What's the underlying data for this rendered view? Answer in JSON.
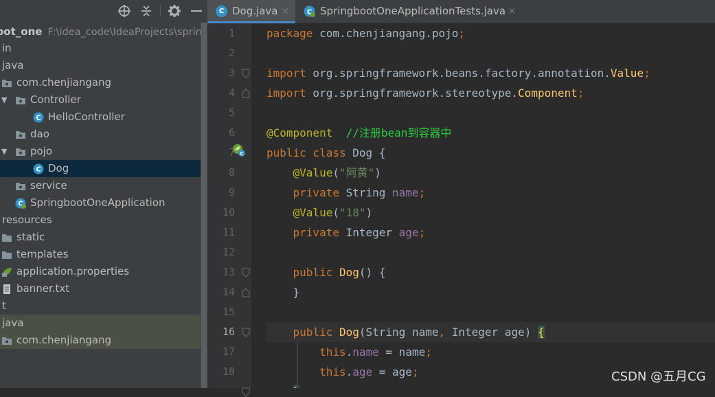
{
  "project": {
    "root_name": "oot_one",
    "root_path": "F:\\idea_code\\IdeaProjects\\spring",
    "toolbar": {
      "locate_icon": "crosshair-icon",
      "collapse_icon": "collapse-all-icon",
      "settings_icon": "gear-icon",
      "hide_icon": "minimize-icon"
    },
    "tree": [
      {
        "label": "in",
        "icon": "none",
        "kind": "plain"
      },
      {
        "label": "java",
        "icon": "none",
        "kind": "plain"
      },
      {
        "label": "com.chenjiangang",
        "icon": "package-icon",
        "kind": "plain"
      },
      {
        "label": "Controller",
        "icon": "package-icon",
        "kind": "expanded"
      },
      {
        "label": "HelloController",
        "icon": "class-icon",
        "kind": "plain"
      },
      {
        "label": "dao",
        "icon": "package-icon",
        "kind": "plain"
      },
      {
        "label": "pojo",
        "icon": "package-icon",
        "kind": "expanded"
      },
      {
        "label": "Dog",
        "icon": "class-icon",
        "kind": "selected"
      },
      {
        "label": "service",
        "icon": "package-icon",
        "kind": "plain"
      },
      {
        "label": "SpringbootOneApplication",
        "icon": "spring-class-icon",
        "kind": "plain"
      },
      {
        "label": "resources",
        "icon": "none",
        "kind": "plain"
      },
      {
        "label": "static",
        "icon": "folder-icon",
        "kind": "plain"
      },
      {
        "label": "templates",
        "icon": "folder-icon",
        "kind": "plain"
      },
      {
        "label": "application.properties",
        "icon": "spring-properties-icon",
        "kind": "plain"
      },
      {
        "label": "banner.txt",
        "icon": "text-file-icon",
        "kind": "plain"
      },
      {
        "label": "t",
        "icon": "none",
        "kind": "plain"
      },
      {
        "label": "java",
        "icon": "none",
        "kind": "test-root"
      },
      {
        "label": "com.chenjiangang",
        "icon": "package-icon",
        "kind": "test-sub"
      }
    ]
  },
  "tabs": [
    {
      "label": "Dog.java",
      "icon": "class-icon",
      "active": true,
      "close": "×"
    },
    {
      "label": "SpringbootOneApplicationTests.java",
      "icon": "spring-test-class-icon",
      "active": false,
      "close": "×"
    }
  ],
  "editor": {
    "line_numbers": [
      "1",
      "2",
      "3",
      "4",
      "5",
      "6",
      "7",
      "8",
      "9",
      "10",
      "11",
      "12",
      "13",
      "14",
      "15",
      "16",
      "17",
      "18"
    ],
    "current_line": "16",
    "comment_text": "//注册bean到容器中",
    "value_name": "\"阿黄\"",
    "value_age": "\"18\""
  },
  "watermark": "CSDN @五月CG",
  "colors": {
    "keyword": "#cc7832",
    "annotation": "#bbb529",
    "string": "#6a8759",
    "field": "#9876aa",
    "method": "#ffc66d",
    "comment": "#2ecc40",
    "selection": "#0d293e"
  }
}
